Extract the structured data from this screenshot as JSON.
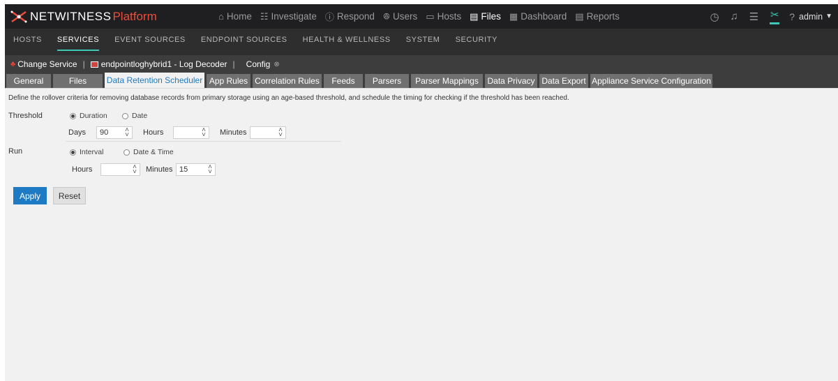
{
  "app": {
    "logo_part1": "NETWITNESS",
    "logo_part2": "Platform"
  },
  "main_nav": [
    {
      "label": "Home",
      "icon": "home-icon",
      "glyph": "⌂"
    },
    {
      "label": "Investigate",
      "icon": "investigate-icon",
      "glyph": "☷"
    },
    {
      "label": "Respond",
      "icon": "respond-icon",
      "glyph": "ⓘ"
    },
    {
      "label": "Users",
      "icon": "users-icon",
      "glyph": "ꔮ"
    },
    {
      "label": "Hosts",
      "icon": "hosts-icon",
      "glyph": "▭"
    },
    {
      "label": "Files",
      "icon": "files-icon",
      "glyph": "▤"
    },
    {
      "label": "Dashboard",
      "icon": "dashboard-icon",
      "glyph": "▦"
    },
    {
      "label": "Reports",
      "icon": "reports-icon",
      "glyph": "▤"
    }
  ],
  "active_main_nav": "Files",
  "right_tools": [
    {
      "icon": "timer-icon",
      "glyph": "◷"
    },
    {
      "icon": "bell-icon",
      "glyph": "♫"
    },
    {
      "icon": "tasks-icon",
      "glyph": "☰"
    },
    {
      "icon": "admin-tools-icon",
      "glyph": "✂"
    }
  ],
  "user": {
    "label": "admin",
    "help_glyph": "?"
  },
  "sub_nav": [
    "HOSTS",
    "SERVICES",
    "EVENT SOURCES",
    "ENDPOINT SOURCES",
    "HEALTH & WELLNESS",
    "SYSTEM",
    "SECURITY"
  ],
  "active_sub_nav": "SERVICES",
  "service_bar": {
    "change_service": "Change Service",
    "service_name": "endpointloghybrid1 - Log Decoder",
    "config": "Config"
  },
  "tabs": [
    "General",
    "Files",
    "Data Retention Scheduler",
    "App Rules",
    "Correlation Rules",
    "Feeds",
    "Parsers",
    "Parser Mappings",
    "Data Privacy",
    "Data Export",
    "Appliance Service Configuration"
  ],
  "active_tab": "Data Retention Scheduler",
  "form": {
    "description": "Define the rollover criteria for removing database records from primary storage using an age-based threshold, and schedule the timing for checking if the threshold has been reached.",
    "threshold_label": "Threshold",
    "threshold_option_duration": "Duration",
    "threshold_option_date": "Date",
    "threshold_selected": "Duration",
    "days_label": "Days",
    "days_value": "90",
    "hours_label": "Hours",
    "hours_value": "",
    "minutes_label": "Minutes",
    "minutes_value": "",
    "run_label": "Run",
    "run_option_interval": "Interval",
    "run_option_datetime": "Date & Time",
    "run_selected": "Interval",
    "run_hours_label": "Hours",
    "run_hours_value": "",
    "run_minutes_label": "Minutes",
    "run_minutes_value": "15",
    "apply": "Apply",
    "reset": "Reset"
  },
  "colors": {
    "accent": "#1e7ac2",
    "teal": "#3ccab6",
    "brand_red": "#e94e3e"
  }
}
